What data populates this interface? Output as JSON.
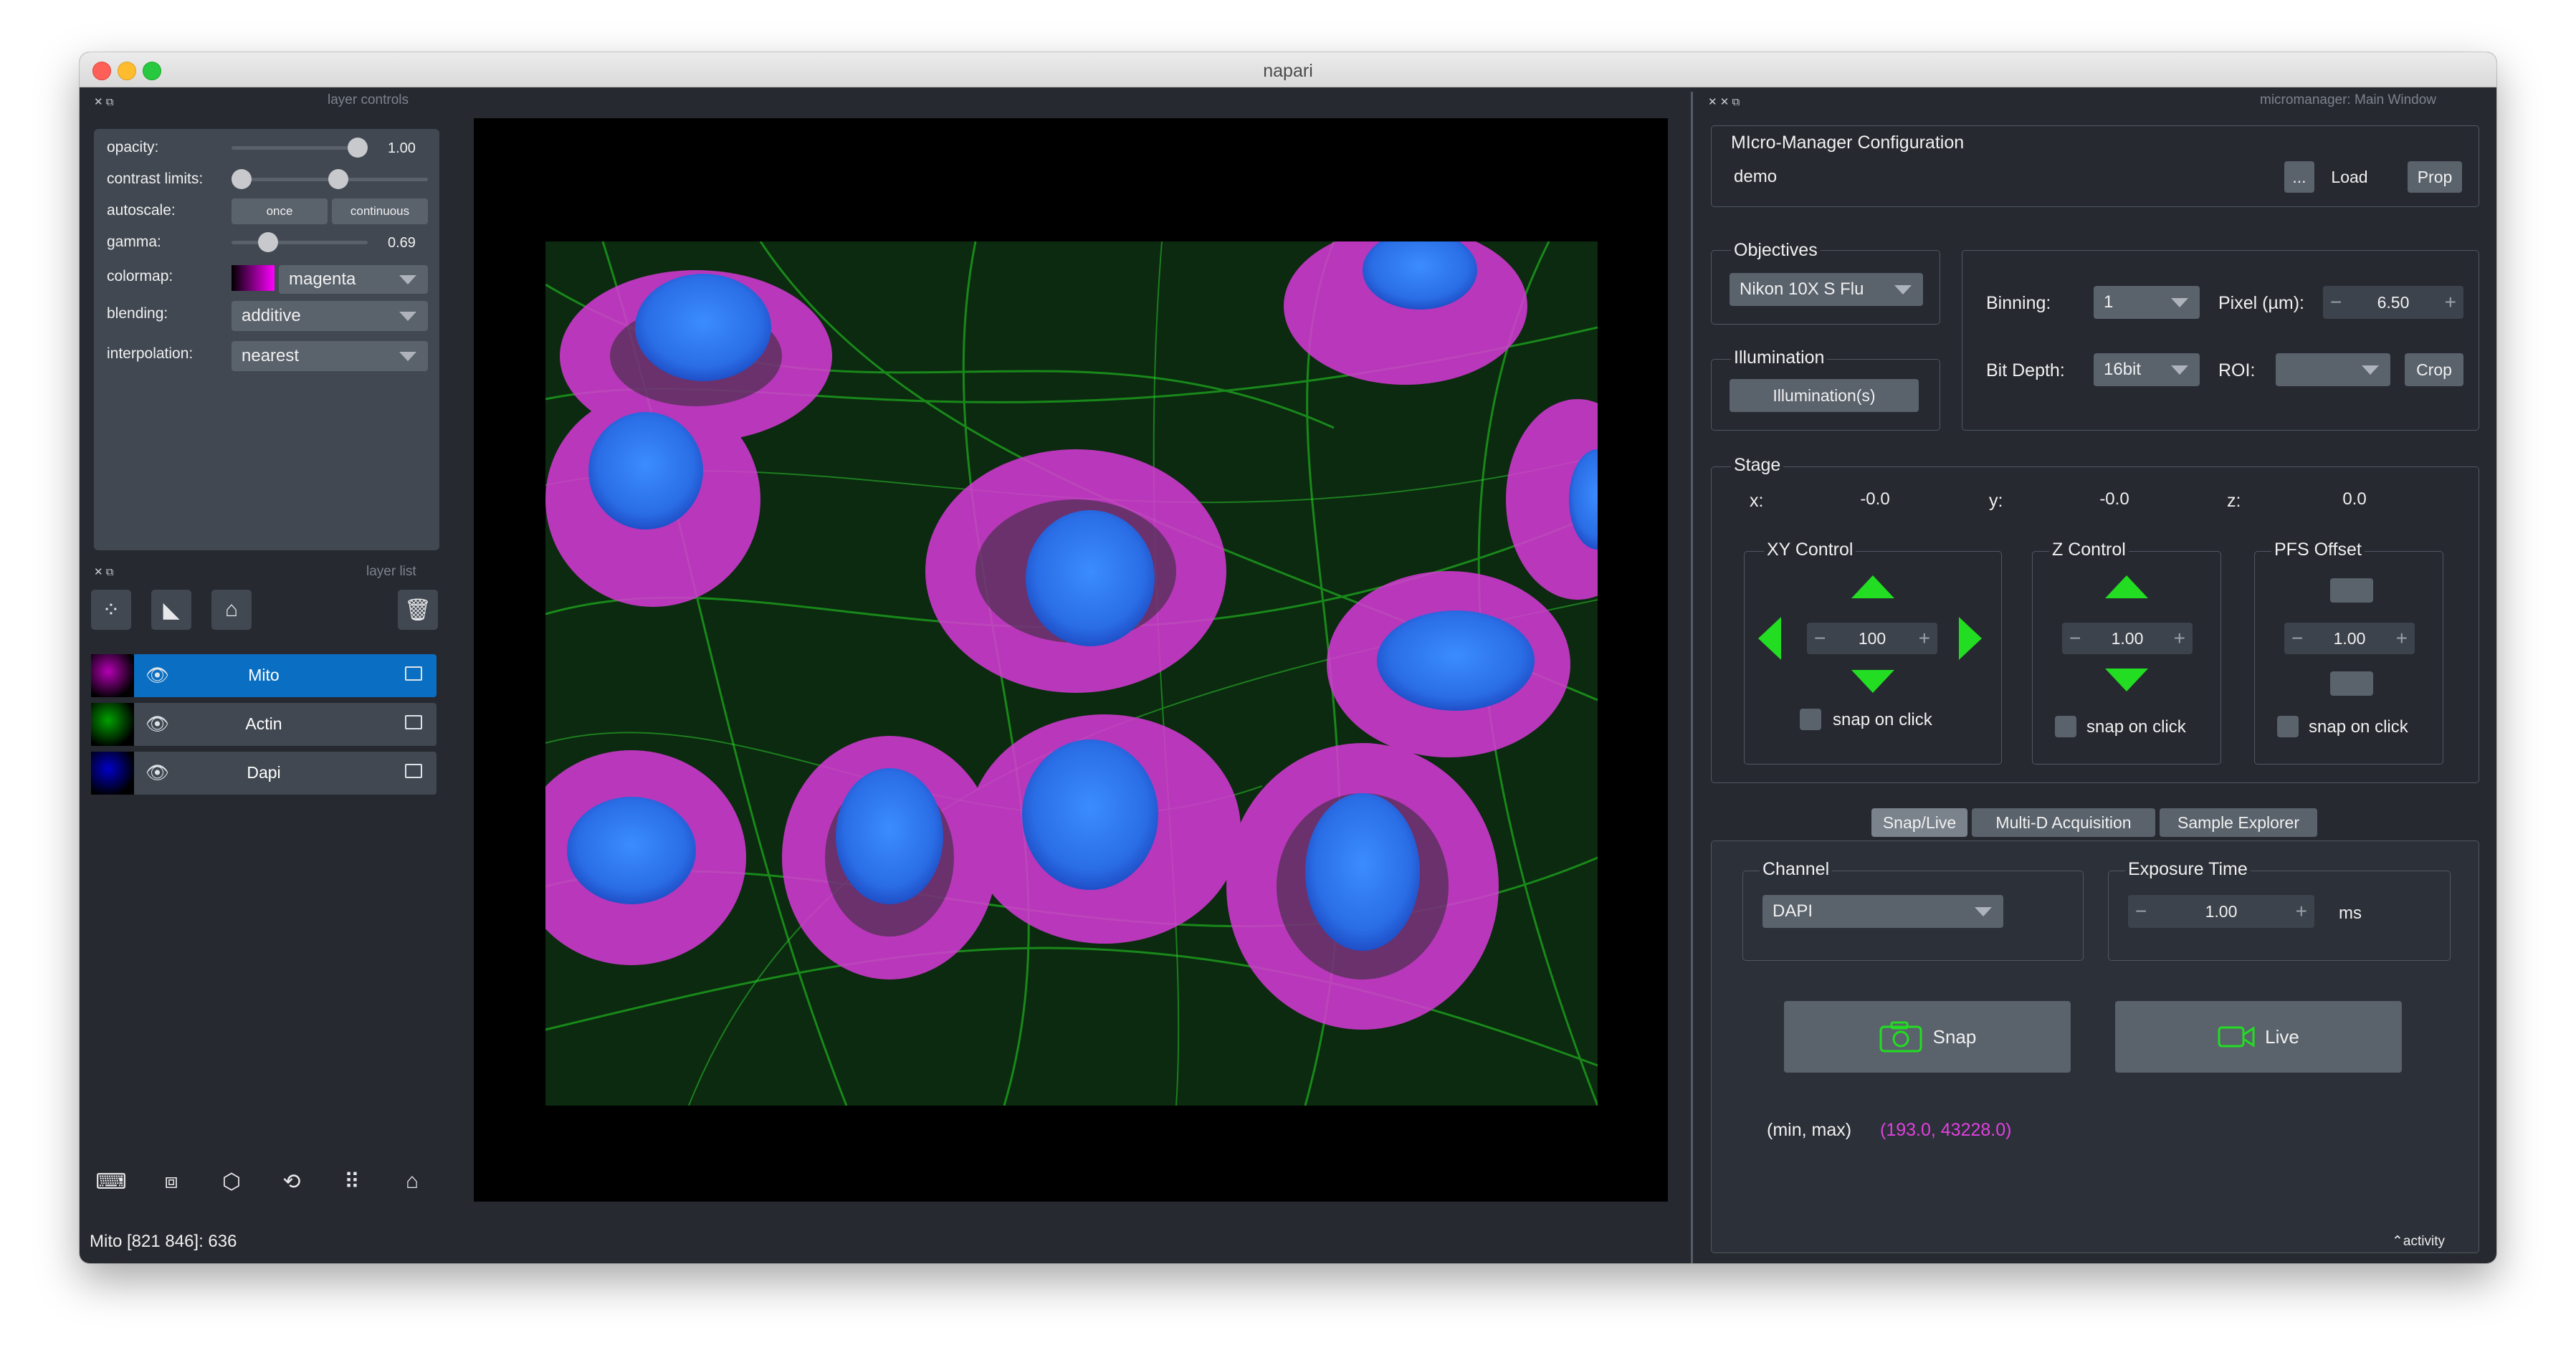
{
  "window": {
    "title": "napari"
  },
  "layer_controls": {
    "dock_title": "layer controls",
    "opacity": {
      "label": "opacity:",
      "value": "1.00",
      "fraction": 1.0
    },
    "contrast_limits": {
      "label": "contrast limits:",
      "low_fraction": 0.0,
      "high_fraction": 0.55
    },
    "autoscale": {
      "label": "autoscale:",
      "once": "once",
      "continuous": "continuous"
    },
    "gamma": {
      "label": "gamma:",
      "value": "0.69",
      "fraction": 0.23
    },
    "colormap": {
      "label": "colormap:",
      "value": "magenta"
    },
    "blending": {
      "label": "blending:",
      "value": "additive"
    },
    "interpolation": {
      "label": "interpolation:",
      "value": "nearest"
    }
  },
  "layer_list": {
    "dock_title": "layer list",
    "layers": [
      {
        "name": "Mito",
        "selected": true,
        "color": "#b400b4"
      },
      {
        "name": "Actin",
        "selected": false,
        "color": "#00a000"
      },
      {
        "name": "Dapi",
        "selected": false,
        "color": "#0000c8"
      }
    ]
  },
  "status_bar": {
    "text": "Mito [821 846]: 636",
    "activity": "activity"
  },
  "micromanager": {
    "dock_title": "micromanager: Main Window",
    "config": {
      "title": "MIcro-Manager Configuration",
      "value": "demo",
      "browse": "...",
      "load": "Load",
      "prop": "Prop"
    },
    "objectives": {
      "title": "Objectives",
      "value": "Nikon 10X S Flu"
    },
    "illumination": {
      "title": "Illumination",
      "button": "Illumination(s)"
    },
    "camera": {
      "binning_label": "Binning:",
      "binning_value": "1",
      "pixel_label": "Pixel (µm):",
      "pixel_value": "6.50",
      "bitdepth_label": "Bit Depth:",
      "bitdepth_value": "16bit",
      "roi_label": "ROI:",
      "roi_value": "",
      "crop": "Crop"
    },
    "stage": {
      "title": "Stage",
      "x_label": "x:",
      "x_value": "-0.0",
      "y_label": "y:",
      "y_value": "-0.0",
      "z_label": "z:",
      "z_value": "0.0",
      "xy_control": {
        "title": "XY Control",
        "step": "100",
        "snap": "snap on click"
      },
      "z_control": {
        "title": "Z Control",
        "step": "1.00",
        "snap": "snap on click"
      },
      "pfs_offset": {
        "title": "PFS Offset",
        "step": "1.00",
        "snap": "snap on click"
      }
    },
    "tabs": [
      "Snap/Live",
      "Multi-D Acquisition",
      "Sample Explorer"
    ],
    "channel": {
      "title": "Channel",
      "value": "DAPI"
    },
    "exposure": {
      "title": "Exposure Time",
      "value": "1.00",
      "unit": "ms"
    },
    "snap": "Snap",
    "live": "Live",
    "minmax_label": "(min, max)",
    "minmax_value": "(193.0, 43228.0)",
    "accent_color": "#22dd22",
    "minmax_color": "#e040e0"
  }
}
